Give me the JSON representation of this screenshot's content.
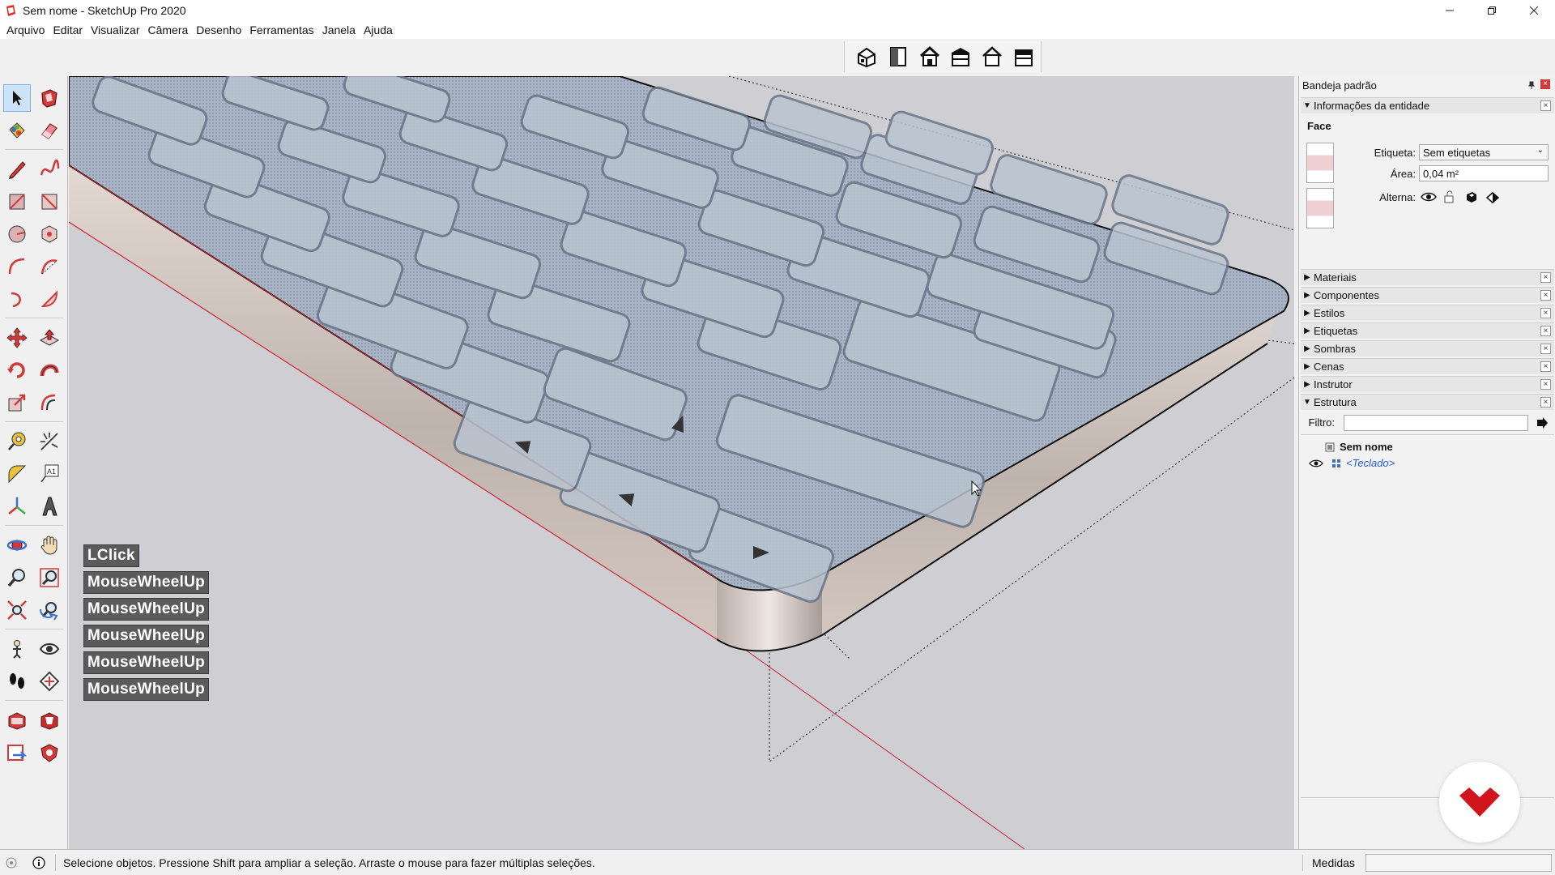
{
  "window": {
    "title": "Sem nome - SketchUp Pro 2020",
    "icon": "sketchup-icon",
    "controls": [
      "minimize-icon",
      "restore-icon",
      "close-icon"
    ]
  },
  "menu": [
    "Arquivo",
    "Editar",
    "Visualizar",
    "Câmera",
    "Desenho",
    "Ferramentas",
    "Janela",
    "Ajuda"
  ],
  "views_toolbar": [
    "iso-view-icon",
    "top-view-icon",
    "front-view-icon",
    "right-view-icon",
    "back-view-icon",
    "left-view-icon"
  ],
  "tools": [
    "select-icon",
    "make-component-icon",
    "paint-bucket-icon",
    "eraser-icon",
    "line-icon",
    "freehand-icon",
    "rectangle-icon",
    "rotated-rectangle-icon",
    "circle-icon",
    "polygon-icon",
    "arc-icon",
    "two-point-arc-icon",
    "three-point-arc-icon",
    "pie-icon",
    "move-icon",
    "push-pull-icon",
    "rotate-icon",
    "follow-me-icon",
    "scale-icon",
    "offset-icon",
    "tape-measure-icon",
    "dimension-icon",
    "protractor-icon",
    "text-icon",
    "axes-icon",
    "3d-text-icon",
    "orbit-icon",
    "pan-icon",
    "zoom-icon",
    "zoom-window-icon",
    "zoom-extents-icon",
    "previous-view-icon",
    "position-camera-icon",
    "look-around-icon",
    "walk-icon",
    "section-plane-icon",
    "warehouse-icon",
    "extension-warehouse-icon",
    "send-to-layout-icon",
    "extension-manager-icon"
  ],
  "keystrokes": [
    "LClick",
    "MouseWheelUp",
    "MouseWheelUp",
    "MouseWheelUp",
    "MouseWheelUp",
    "MouseWheelUp"
  ],
  "tray": {
    "title": "Bandeja padrão",
    "entity_info": {
      "header": "Informações da entidade",
      "type": "Face",
      "tag_label": "Etiqueta:",
      "tag_value": "Sem etiquetas",
      "area_label": "Área:",
      "area_value": "0,04 m²",
      "toggles_label": "Alterna:"
    },
    "panels": [
      "Materiais",
      "Componentes",
      "Estilos",
      "Etiquetas",
      "Sombras",
      "Cenas",
      "Instrutor"
    ],
    "outliner": {
      "header": "Estrutura",
      "filter_label": "Filtro:",
      "filter_value": "",
      "root": "Sem nome",
      "child": "<Teclado>"
    }
  },
  "status": {
    "text": "Selecione objetos. Pressione Shift para ampliar a seleção. Arraste o mouse para fazer múltiplas seleções.",
    "measures_label": "Medidas",
    "measures_value": ""
  },
  "colors": {
    "keyboard_top": "#a9b4c4",
    "keyboard_side": "#c9beb8",
    "viewport_bg": "#cfcfd3",
    "red_axis": "#cc2233",
    "logo": "#d1141b"
  }
}
